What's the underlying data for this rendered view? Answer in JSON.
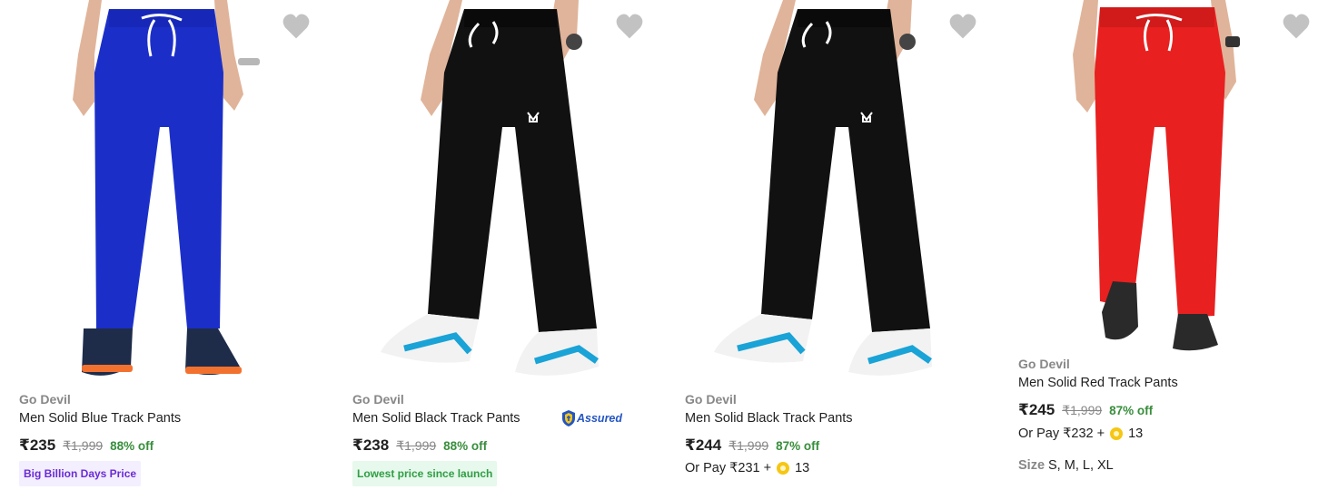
{
  "products": [
    {
      "brand": "Go Devil",
      "title": "Men Solid Blue Track Pants",
      "price": "₹235",
      "mrp": "₹1,999",
      "discount": "88% off",
      "tag": "Big Billion Days Price",
      "pants_color": "#1b2fc8"
    },
    {
      "brand": "Go Devil",
      "title": "Men Solid Black Track Pants",
      "price": "₹238",
      "mrp": "₹1,999",
      "discount": "88% off",
      "tag": "Lowest price since launch",
      "assured": "Assured",
      "pants_color": "#111111"
    },
    {
      "brand": "Go Devil",
      "title": "Men Solid Black Track Pants",
      "price": "₹244",
      "mrp": "₹1,999",
      "discount": "87% off",
      "pay_with": "Or Pay ₹231 +",
      "coins": "13",
      "pants_color": "#111111"
    },
    {
      "brand": "Go Devil",
      "title": "Men Solid Red Track Pants",
      "price": "₹245",
      "mrp": "₹1,999",
      "discount": "87% off",
      "pay_with": "Or Pay ₹232 +",
      "coins": "13",
      "size_label": "Size",
      "sizes": "S, M, L, XL",
      "pants_color": "#e82020"
    }
  ],
  "colors": {
    "discount_green": "#388e3c",
    "brand_grey": "#878787",
    "wishlist_grey": "#c2c2c2",
    "assured_blue": "#2455c3",
    "coin_yellow": "#f6c614"
  },
  "icons": {
    "wishlist": "heart-icon",
    "assured": "assured-shield-icon",
    "coin": "supercoin-icon"
  }
}
